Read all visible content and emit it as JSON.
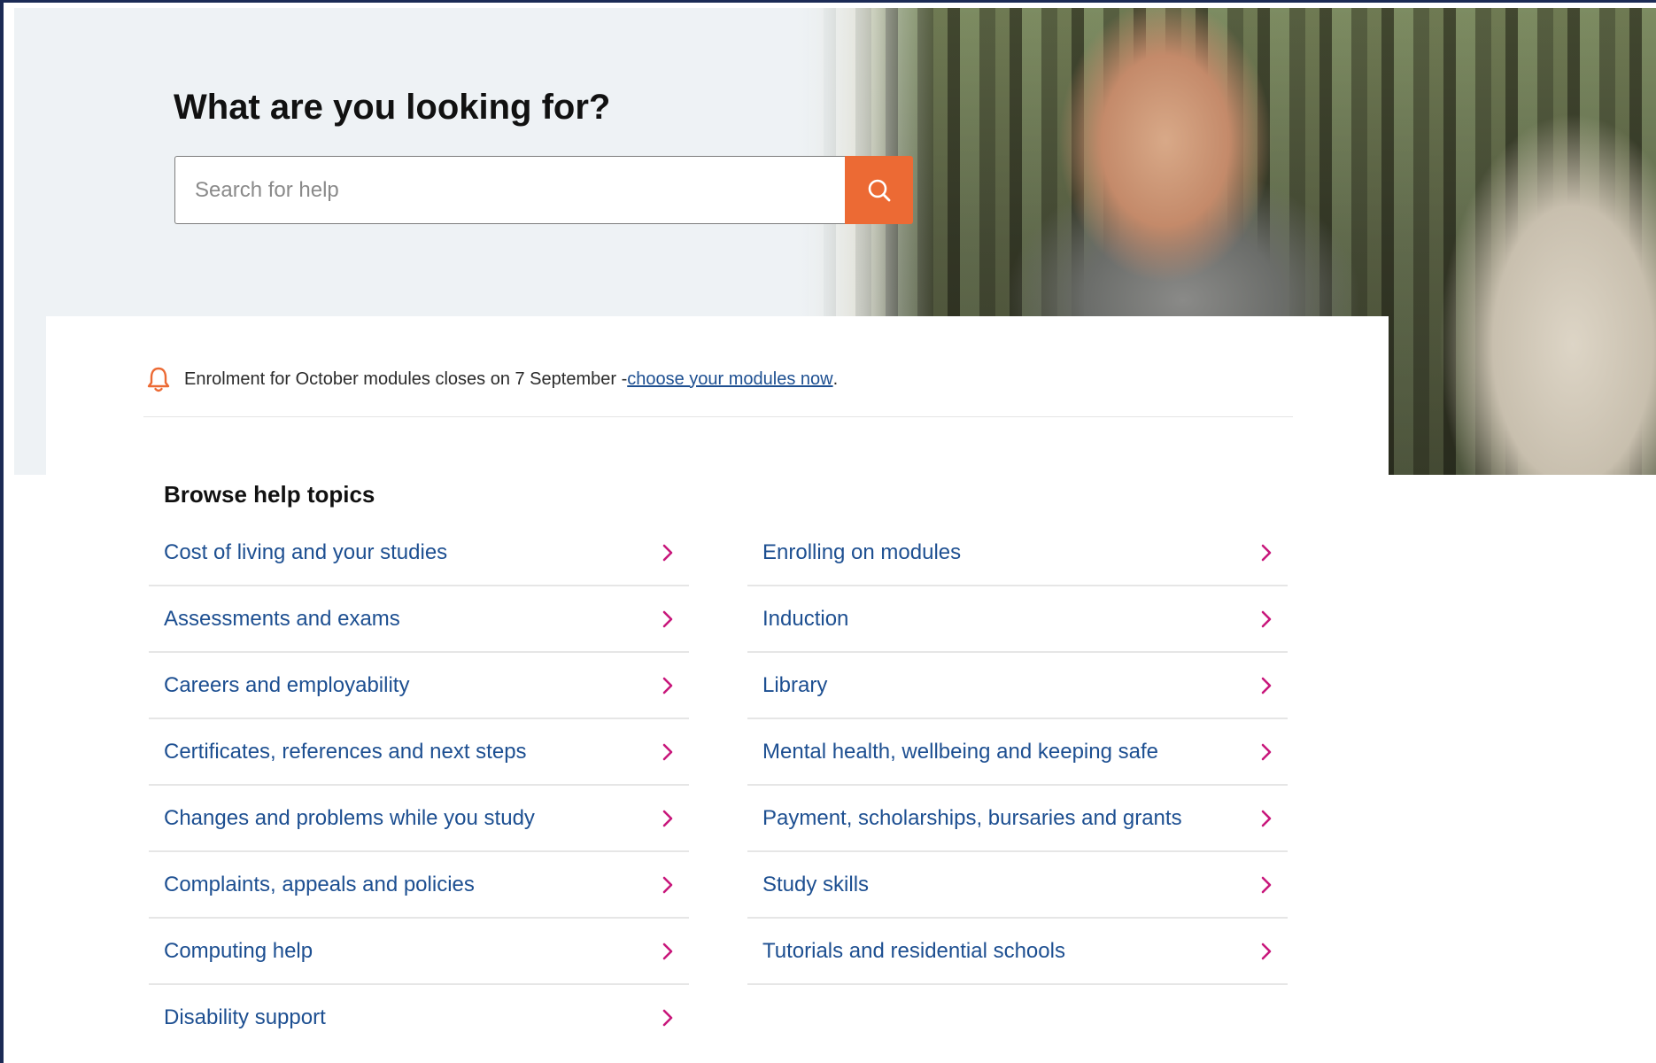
{
  "hero": {
    "title": "What are you looking for?",
    "photo_description_icon": "hero-photo-student"
  },
  "search": {
    "placeholder": "Search for help",
    "value": "",
    "icon": "search-icon"
  },
  "alert": {
    "icon": "bell-icon",
    "text": "Enrolment for October modules closes on 7 September - ",
    "link_text": "choose your modules now",
    "suffix": "."
  },
  "browse": {
    "title": "Browse help topics",
    "left_topics": [
      {
        "label": "Cost of living and your studies"
      },
      {
        "label": "Assessments and exams"
      },
      {
        "label": "Careers and employability"
      },
      {
        "label": "Certificates, references and next steps"
      },
      {
        "label": "Changes and problems while you study"
      },
      {
        "label": "Complaints, appeals and policies"
      },
      {
        "label": "Computing help"
      },
      {
        "label": "Disability support"
      }
    ],
    "right_topics": [
      {
        "label": "Enrolling on modules"
      },
      {
        "label": "Induction"
      },
      {
        "label": "Library"
      },
      {
        "label": "Mental health, wellbeing and keeping safe"
      },
      {
        "label": "Payment, scholarships, bursaries and grants"
      },
      {
        "label": "Study skills"
      },
      {
        "label": "Tutorials and residential schools"
      }
    ]
  },
  "colors": {
    "accent": "#ec6a34",
    "link": "#1d4f91",
    "chevron": "#c8177b",
    "frame": "#1b2a55"
  }
}
